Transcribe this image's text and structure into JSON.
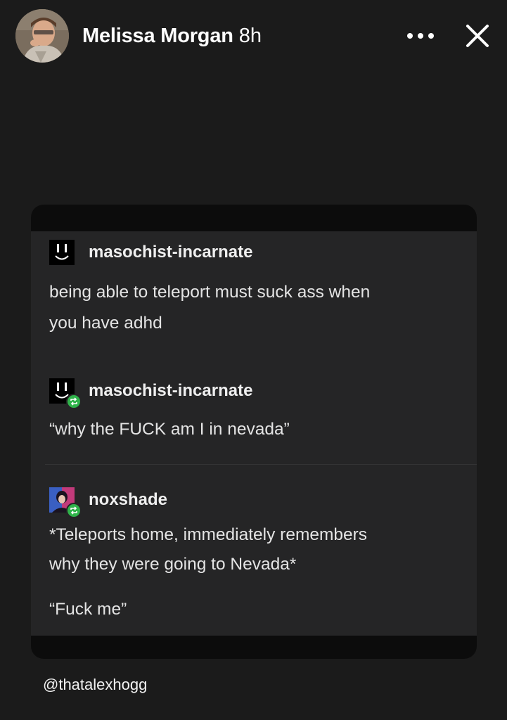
{
  "header": {
    "user_name": "Melissa Morgan",
    "time": "8h",
    "more_icon": "more-horizontal-icon",
    "close_icon": "close-icon"
  },
  "posts": [
    {
      "blog": "masochist-incarnate",
      "avatar_icon": "smiley-avatar-icon",
      "reblogged": false,
      "lines": [
        "being able to teleport must suck ass when",
        "you have adhd"
      ]
    },
    {
      "blog": "masochist-incarnate",
      "avatar_icon": "smiley-avatar-icon",
      "reblogged": true,
      "lines": [
        "“why the FUCK am I in nevada”"
      ]
    },
    {
      "blog": "noxshade",
      "avatar_icon": "portrait-avatar-icon",
      "reblogged": true,
      "lines": [
        "*Teleports home, immediately remembers",
        "why they were going to Nevada*"
      ],
      "quote": "“Fuck me”"
    }
  ],
  "credit": "@thatalexhogg",
  "colors": {
    "background": "#1b1b1b",
    "card": "#252526",
    "reblog_green": "#2fb34a"
  }
}
